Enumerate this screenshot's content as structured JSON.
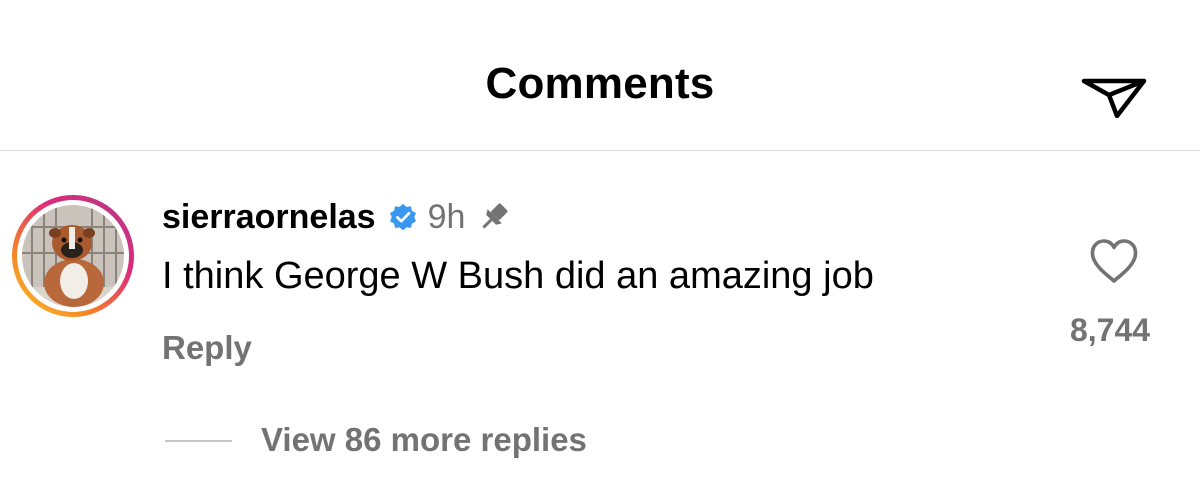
{
  "header": {
    "title": "Comments",
    "share_icon": "send-icon"
  },
  "comment": {
    "username": "sierraornelas",
    "verified_icon": "verified-badge-icon",
    "verified_color": "#3897f0",
    "time": "9h",
    "pin_icon": "pin-icon",
    "text": "I think George W Bush did an amazing job",
    "reply_label": "Reply",
    "like_icon": "heart-icon",
    "like_count": "8,744",
    "view_replies_label": "View 86 more replies"
  },
  "colors": {
    "secondary_text": "#737373",
    "divider": "#dbdbdb",
    "story_ring_start": "#f9c626",
    "story_ring_end": "#b322b5"
  }
}
